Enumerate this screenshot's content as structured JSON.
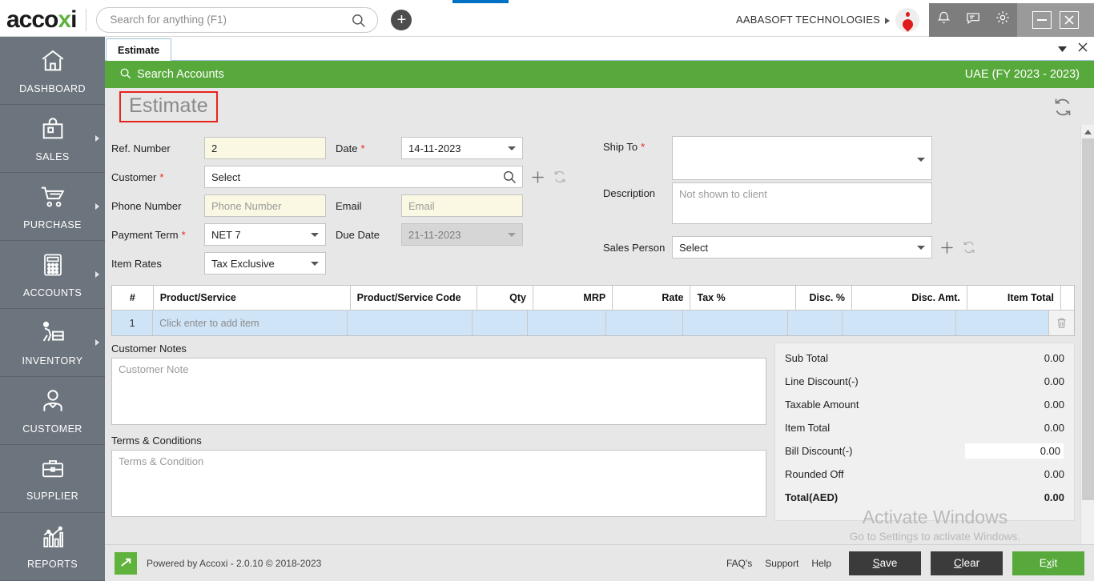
{
  "app": {
    "logo_text": "accoxi",
    "logo_accent_color": "#5fb33c"
  },
  "topbar": {
    "search_placeholder": "Search for anything (F1)",
    "search_value": "",
    "add_button_label": "+",
    "company_name": "AABASOFT TECHNOLOGIES",
    "icons": [
      "bell-icon",
      "message-icon",
      "gear-icon"
    ],
    "window_minimize": "minimize-icon",
    "window_close": "close-icon"
  },
  "sidebar": {
    "items": [
      {
        "label": "DASHBOARD",
        "icon": "home-icon",
        "has_arrow": false
      },
      {
        "label": "SALES",
        "icon": "shopping-bag-icon",
        "has_arrow": true
      },
      {
        "label": "PURCHASE",
        "icon": "shopping-cart-icon",
        "has_arrow": true
      },
      {
        "label": "ACCOUNTS",
        "icon": "calculator-icon",
        "has_arrow": true
      },
      {
        "label": "INVENTORY",
        "icon": "trolley-icon",
        "has_arrow": true
      },
      {
        "label": "CUSTOMER",
        "icon": "person-icon",
        "has_arrow": false
      },
      {
        "label": "SUPPLIER",
        "icon": "briefcase-icon",
        "has_arrow": false
      },
      {
        "label": "REPORTS",
        "icon": "bar-chart-icon",
        "has_arrow": false
      }
    ]
  },
  "tabs": {
    "active_tab": "Estimate",
    "dropdown_icon": "chevron-down-icon",
    "close_icon": "close-icon"
  },
  "greenbar": {
    "search_accounts": "Search Accounts",
    "fiscal_year": "UAE (FY 2023 - 2023)",
    "color": "#57a93c"
  },
  "page": {
    "title": "Estimate",
    "title_highlight_color": "#e8241c",
    "refresh_icon": "refresh-icon"
  },
  "form": {
    "ref_number": {
      "label": "Ref. Number",
      "value": "2",
      "required": false
    },
    "date": {
      "label": "Date",
      "value": "14-11-2023",
      "required": true
    },
    "customer": {
      "label": "Customer",
      "value": "Select",
      "required": true
    },
    "ship_to": {
      "label": "Ship To",
      "value": "",
      "required": true
    },
    "phone_number": {
      "label": "Phone Number",
      "placeholder": "Phone Number",
      "value": "",
      "required": false
    },
    "email": {
      "label": "Email",
      "placeholder": "Email",
      "value": "",
      "required": false
    },
    "description": {
      "label": "Description",
      "placeholder": "Not shown to client",
      "value": ""
    },
    "payment_term": {
      "label": "Payment Term",
      "value": "NET 7",
      "required": true
    },
    "due_date": {
      "label": "Due Date",
      "value": "21-11-2023",
      "disabled": true
    },
    "item_rates": {
      "label": "Item Rates",
      "value": "Tax Exclusive"
    },
    "sales_person": {
      "label": "Sales Person",
      "value": "Select"
    }
  },
  "items_table": {
    "columns": [
      "#",
      "Product/Service",
      "Product/Service Code",
      "Qty",
      "MRP",
      "Rate",
      "Tax %",
      "Disc. %",
      "Disc. Amt.",
      "Item Total"
    ],
    "rows": [
      {
        "index": "1",
        "product": "Click enter to add item",
        "code": "",
        "qty": "",
        "mrp": "",
        "rate": "",
        "tax": "",
        "disc_pct": "",
        "disc_amt": "",
        "item_total": ""
      }
    ],
    "delete_icon": "trash-icon"
  },
  "notes": {
    "customer_notes_label": "Customer Notes",
    "customer_notes_placeholder": "Customer Note",
    "customer_notes_value": "",
    "terms_label": "Terms & Conditions",
    "terms_placeholder": "Terms & Condition",
    "terms_value": ""
  },
  "totals": [
    {
      "label": "Sub Total",
      "value": "0.00",
      "editable": false,
      "bold": false
    },
    {
      "label": "Line Discount(-)",
      "value": "0.00",
      "editable": false,
      "bold": false
    },
    {
      "label": "Taxable Amount",
      "value": "0.00",
      "editable": false,
      "bold": false
    },
    {
      "label": "Item Total",
      "value": "0.00",
      "editable": false,
      "bold": false
    },
    {
      "label": "Bill Discount(-)",
      "value": "0.00",
      "editable": true,
      "bold": false
    },
    {
      "label": "Rounded Off",
      "value": "0.00",
      "editable": false,
      "bold": false
    },
    {
      "label": "Total(AED)",
      "value": "0.00",
      "editable": false,
      "bold": true
    }
  ],
  "watermark": {
    "line1": "Activate Windows",
    "line2": "Go to Settings to activate Windows."
  },
  "footer": {
    "powered_by": "Powered by Accoxi - 2.0.10 © 2018-2023",
    "links": [
      "FAQ's",
      "Support",
      "Help"
    ],
    "buttons": [
      {
        "label": "Save",
        "accel": "S",
        "style": "dark"
      },
      {
        "label": "Clear",
        "accel": "C",
        "style": "dark"
      },
      {
        "label": "Exit",
        "accel": "x",
        "style": "green"
      }
    ]
  }
}
